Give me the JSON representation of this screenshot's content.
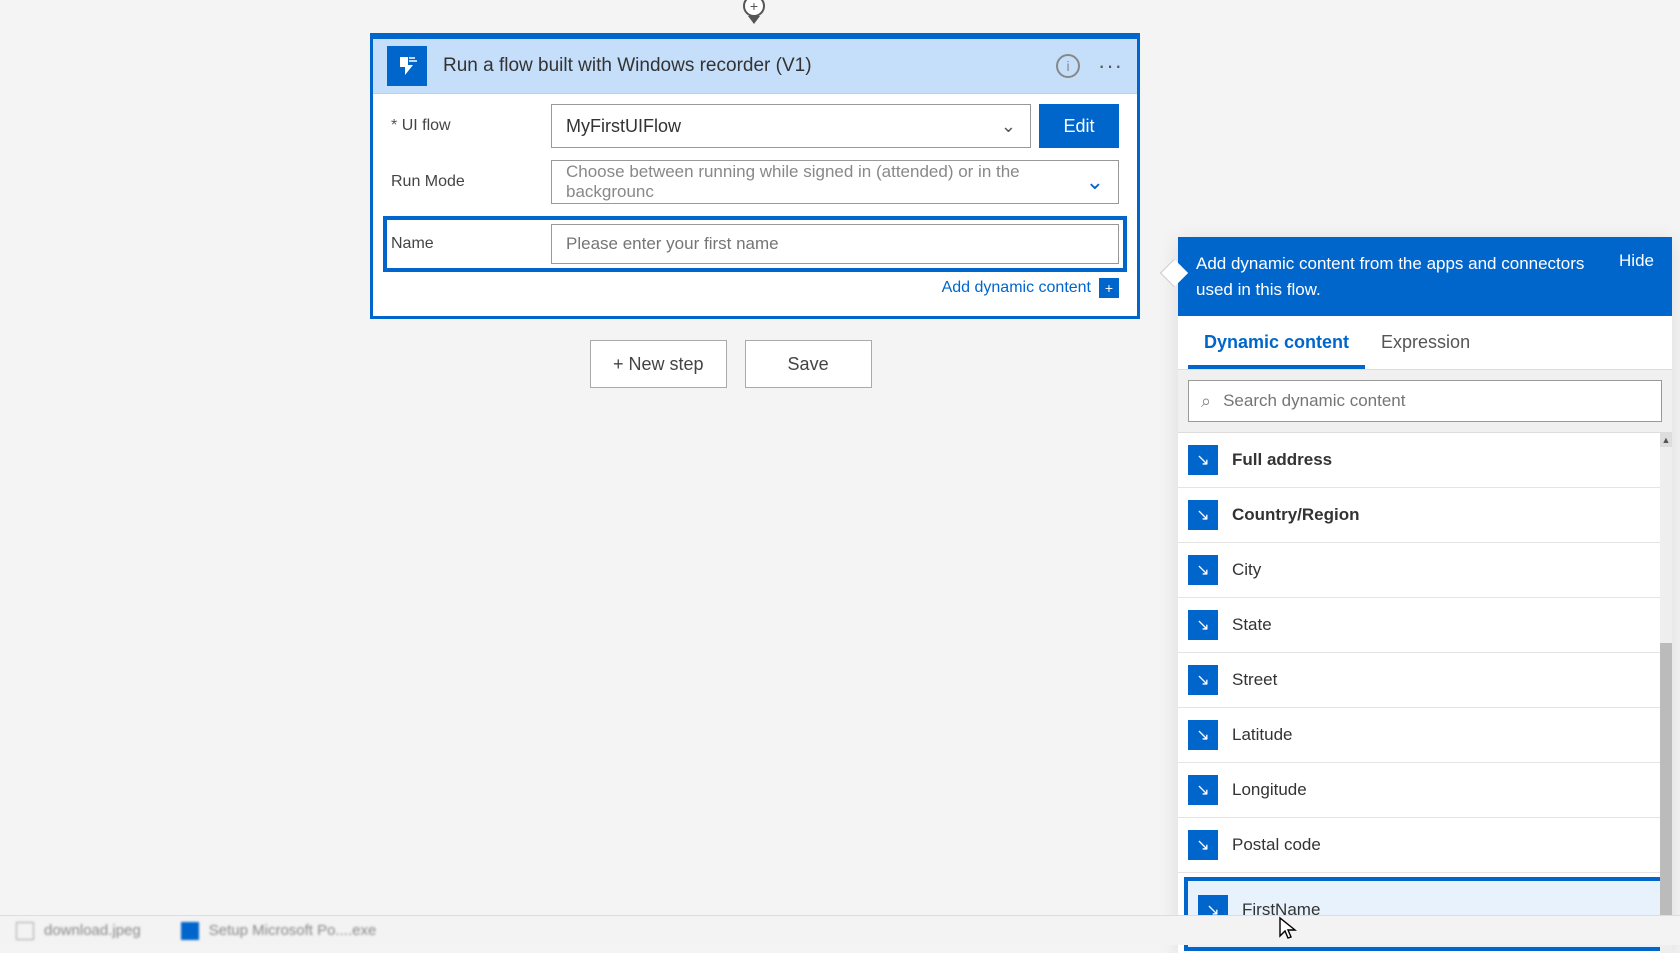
{
  "connector": {
    "top_plus": "+"
  },
  "card": {
    "title": "Run a flow built with Windows recorder (V1)",
    "rows": {
      "uiflow": {
        "label": "UI flow",
        "required": "*",
        "value": "MyFirstUIFlow",
        "edit": "Edit"
      },
      "runmode": {
        "label": "Run Mode",
        "placeholder": "Choose between running while signed in (attended) or in the backgrounc"
      },
      "name": {
        "label": "Name",
        "placeholder": "Please enter your first name"
      }
    },
    "add_dynamic_link": "Add dynamic content"
  },
  "buttons": {
    "new_step": "+  New step",
    "save": "Save"
  },
  "panel": {
    "header_text": "Add dynamic content from the apps and connectors used in this flow.",
    "hide": "Hide",
    "tabs": {
      "dynamic": "Dynamic content",
      "expression": "Expression"
    },
    "search_placeholder": "Search dynamic content",
    "items": [
      {
        "label": "Full address"
      },
      {
        "label": "Country/Region"
      },
      {
        "label": "City"
      },
      {
        "label": "State"
      },
      {
        "label": "Street"
      },
      {
        "label": "Latitude"
      },
      {
        "label": "Longitude"
      },
      {
        "label": "Postal code"
      },
      {
        "label": "FirstName",
        "highlighted": true
      }
    ]
  },
  "taskbar": {
    "item1": "download.jpeg",
    "item2": "Setup Microsoft Po....exe"
  }
}
